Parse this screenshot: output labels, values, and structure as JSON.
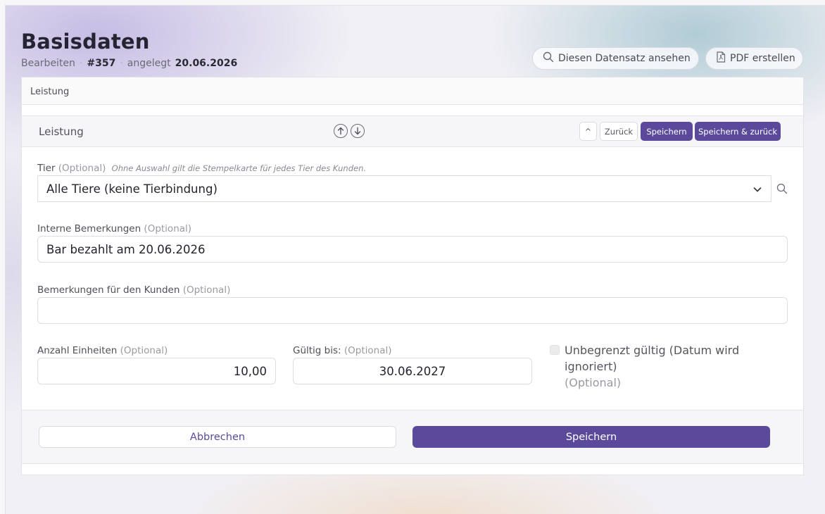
{
  "header": {
    "title": "Basisdaten",
    "mode": "Bearbeiten",
    "record_id": "#357",
    "created_label": "angelegt",
    "created_date": "20.06.2026",
    "view_button": "Diesen Datensatz ansehen",
    "pdf_button": "PDF erstellen"
  },
  "tab": {
    "label": "Leistung"
  },
  "section": {
    "title": "Leistung",
    "collapse_label": "^",
    "back_label": "Zurück",
    "save_label": "Speichern",
    "save_back_label": "Speichern & zurück"
  },
  "fields": {
    "tier": {
      "label": "Tier",
      "optional": "(Optional)",
      "hint": "Ohne Auswahl gilt die Stempelkarte für jedes Tier des Kunden.",
      "value": "Alle Tiere (keine Tierbindung)"
    },
    "internal_notes": {
      "label": "Interne Bemerkungen",
      "optional": "(Optional)",
      "value": "Bar bezahlt am 20.06.2026"
    },
    "customer_notes": {
      "label": "Bemerkungen für den Kunden",
      "optional": "(Optional)",
      "value": ""
    },
    "units": {
      "label": "Anzahl Einheiten",
      "optional": "(Optional)",
      "value": "10,00"
    },
    "valid_until": {
      "label": "Gültig bis:",
      "optional": "(Optional)",
      "value": "30.06.2027"
    },
    "unlimited": {
      "label": "Unbegrenzt gültig (Datum wird ignoriert)",
      "optional": "(Optional)",
      "checked": false
    }
  },
  "footer": {
    "cancel_label": "Abbrechen",
    "save_label": "Speichern"
  },
  "colors": {
    "accent": "#5b4a9c",
    "background": "#f1f0f5"
  }
}
